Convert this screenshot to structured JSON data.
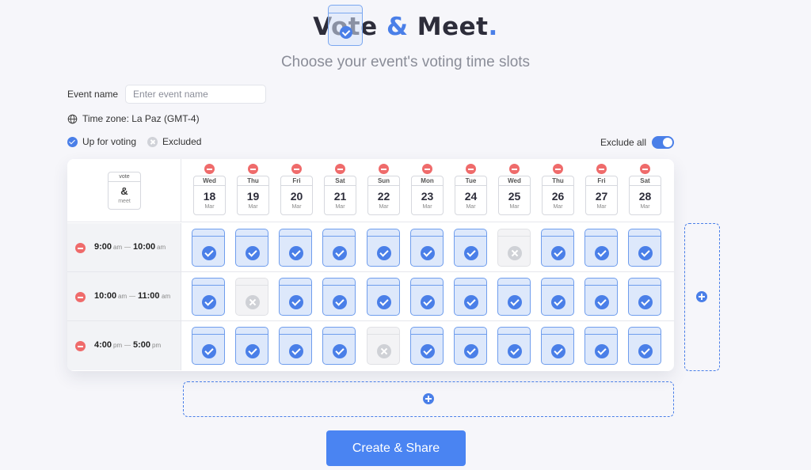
{
  "app": {
    "logo_word1": "Vote",
    "logo_amp": "&",
    "logo_word2": "Meet",
    "logo_dot": ".",
    "subtitle": "Choose your event's voting time slots"
  },
  "form": {
    "event_name_label": "Event name",
    "event_name_placeholder": "Enter event name",
    "event_name_value": "",
    "timezone_label": "Time zone: La Paz (GMT-4)"
  },
  "legend": {
    "up_for_voting": "Up for voting",
    "excluded": "Excluded"
  },
  "exclude_all": {
    "label": "Exclude all",
    "enabled": true
  },
  "mini_logo": {
    "top": "vote",
    "amp": "&",
    "bottom": "meet"
  },
  "days": [
    {
      "weekday": "Wed",
      "day": "18",
      "month": "Mar"
    },
    {
      "weekday": "Thu",
      "day": "19",
      "month": "Mar"
    },
    {
      "weekday": "Fri",
      "day": "20",
      "month": "Mar"
    },
    {
      "weekday": "Sat",
      "day": "21",
      "month": "Mar"
    },
    {
      "weekday": "Sun",
      "day": "22",
      "month": "Mar"
    },
    {
      "weekday": "Mon",
      "day": "23",
      "month": "Mar"
    },
    {
      "weekday": "Tue",
      "day": "24",
      "month": "Mar"
    },
    {
      "weekday": "Wed",
      "day": "25",
      "month": "Mar"
    },
    {
      "weekday": "Thu",
      "day": "26",
      "month": "Mar"
    },
    {
      "weekday": "Fri",
      "day": "27",
      "month": "Mar"
    },
    {
      "weekday": "Sat",
      "day": "28",
      "month": "Mar"
    }
  ],
  "time_slots": [
    {
      "start": "9:00",
      "start_ampm": "am",
      "end": "10:00",
      "end_ampm": "am",
      "states": [
        "on",
        "on",
        "on",
        "on",
        "on",
        "on",
        "on",
        "off",
        "on",
        "on",
        "on"
      ]
    },
    {
      "start": "10:00",
      "start_ampm": "am",
      "end": "11:00",
      "end_ampm": "am",
      "states": [
        "on",
        "off",
        "on",
        "on",
        "on",
        "on",
        "on",
        "on",
        "on",
        "on",
        "on"
      ]
    },
    {
      "start": "4:00",
      "start_ampm": "pm",
      "end": "5:00",
      "end_ampm": "pm",
      "states": [
        "on",
        "on",
        "on",
        "on",
        "off",
        "on",
        "on",
        "on",
        "on",
        "on",
        "on"
      ]
    }
  ],
  "create_button": "Create & Share",
  "colors": {
    "accent": "#4a7fe8",
    "remove": "#ef6b6b",
    "slot_on_bg": "#dde8fb",
    "slot_off_bg": "#f3f3f5"
  },
  "icons": {
    "globe": "globe-icon",
    "remove": "minus-circle-icon",
    "add": "plus-circle-icon",
    "check": "check-circle-icon",
    "excluded": "x-circle-icon"
  }
}
